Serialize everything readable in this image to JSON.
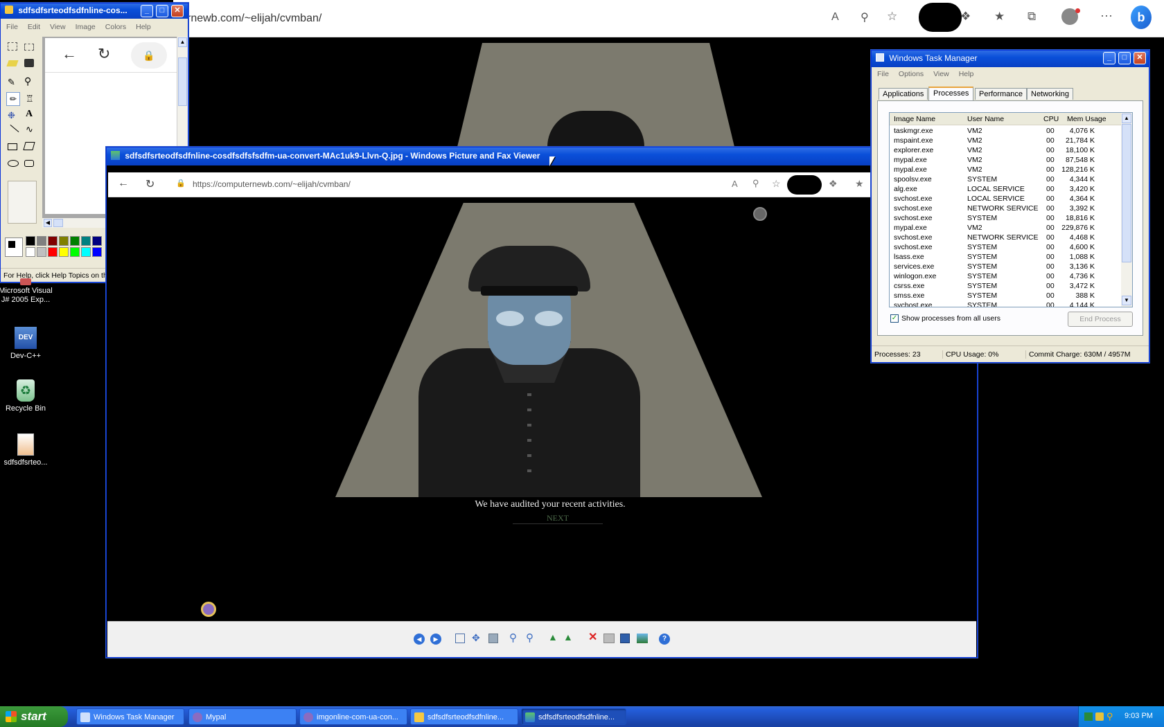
{
  "background_browser": {
    "url": "rnewb.com/~elijah/cvmban/"
  },
  "paint": {
    "title": "sdfsdfsrteodfsdfnline-cos...",
    "menu": [
      "File",
      "Edit",
      "View",
      "Image",
      "Colors",
      "Help"
    ],
    "status": "For Help, click Help Topics on th"
  },
  "desktop_icons": [
    {
      "label": "Microsoft Visual J# 2005 Exp..."
    },
    {
      "label": "Dev-C++"
    },
    {
      "label": "Recycle Bin"
    },
    {
      "label": "sdfsdfsrteo..."
    }
  ],
  "viewer": {
    "title": "sdfsdfsrteodfsdfnline-cosdfsdfsfsdfm-ua-convert-MAc1uk9-Llvn-Q.jpg - Windows Picture and Fax Viewer",
    "url": "https://computernewb.com/~elijah/cvmban/",
    "caption": "We have audited your recent activities.",
    "next_label": "NEXT"
  },
  "task_manager": {
    "title": "Windows Task Manager",
    "menu": [
      "File",
      "Options",
      "View",
      "Help"
    ],
    "tabs": [
      "Applications",
      "Processes",
      "Performance",
      "Networking"
    ],
    "active_tab": "Processes",
    "columns": [
      "Image Name",
      "User Name",
      "CPU",
      "Mem Usage"
    ],
    "rows": [
      [
        "taskmgr.exe",
        "VM2",
        "00",
        "4,076 K"
      ],
      [
        "mspaint.exe",
        "VM2",
        "00",
        "21,784 K"
      ],
      [
        "explorer.exe",
        "VM2",
        "00",
        "18,100 K"
      ],
      [
        "mypal.exe",
        "VM2",
        "00",
        "87,548 K"
      ],
      [
        "mypal.exe",
        "VM2",
        "00",
        "128,216 K"
      ],
      [
        "spoolsv.exe",
        "SYSTEM",
        "00",
        "4,344 K"
      ],
      [
        "alg.exe",
        "LOCAL SERVICE",
        "00",
        "3,420 K"
      ],
      [
        "svchost.exe",
        "LOCAL SERVICE",
        "00",
        "4,364 K"
      ],
      [
        "svchost.exe",
        "NETWORK SERVICE",
        "00",
        "3,392 K"
      ],
      [
        "svchost.exe",
        "SYSTEM",
        "00",
        "18,816 K"
      ],
      [
        "mypal.exe",
        "VM2",
        "00",
        "229,876 K"
      ],
      [
        "svchost.exe",
        "NETWORK SERVICE",
        "00",
        "4,468 K"
      ],
      [
        "svchost.exe",
        "SYSTEM",
        "00",
        "4,600 K"
      ],
      [
        "lsass.exe",
        "SYSTEM",
        "00",
        "1,088 K"
      ],
      [
        "services.exe",
        "SYSTEM",
        "00",
        "3,136 K"
      ],
      [
        "winlogon.exe",
        "SYSTEM",
        "00",
        "4,736 K"
      ],
      [
        "csrss.exe",
        "SYSTEM",
        "00",
        "3,472 K"
      ],
      [
        "smss.exe",
        "SYSTEM",
        "00",
        "388 K"
      ],
      [
        "svchost.exe",
        "SYSTEM",
        "00",
        "4,144 K"
      ]
    ],
    "show_all_label": "Show processes from all users",
    "end_process_label": "End Process",
    "status_processes": "Processes: 23",
    "status_cpu": "CPU Usage: 0%",
    "status_commit": "Commit Charge: 630M / 4957M"
  },
  "taskbar": {
    "start_label": "start",
    "items": [
      {
        "label": "Windows Task Manager"
      },
      {
        "label": "Mypal"
      },
      {
        "label": "imgonline-com-ua-con..."
      },
      {
        "label": "sdfsdfsrteodfsdfnline..."
      },
      {
        "label": "sdfsdfsrteodfsdfnline..."
      }
    ],
    "clock": "9:03 PM"
  }
}
